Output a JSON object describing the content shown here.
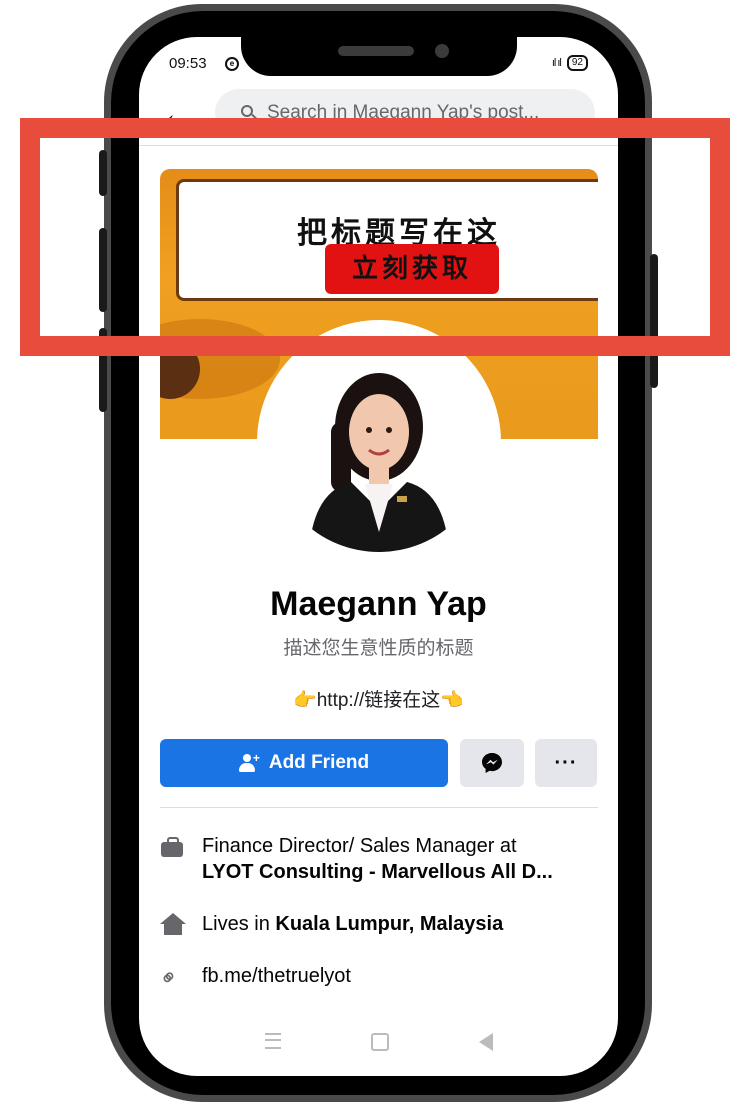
{
  "status_bar": {
    "time": "09:53",
    "battery": "92",
    "signal": "ıl ıl"
  },
  "search": {
    "placeholder": "Search in Maegann Yap's post..."
  },
  "cover": {
    "title": "把标题写在这",
    "button": "立刻获取"
  },
  "profile": {
    "name": "Maegann Yap",
    "subtitle": "描述您生意性质的标题",
    "link": "👉http://链接在这👈"
  },
  "actions": {
    "add_friend": "Add Friend",
    "more": "···"
  },
  "info": {
    "work_line1": "Finance Director/ Sales Manager at",
    "work_line2": "LYOT Consulting - Marvellous All D...",
    "lives_prefix": "Lives in",
    "lives_place": "Kuala Lumpur, Malaysia",
    "website": "fb.me/thetruelyot"
  },
  "colors": {
    "accent": "#1b74e4",
    "highlight": "#e74c3c",
    "cover_button": "#e21212"
  }
}
